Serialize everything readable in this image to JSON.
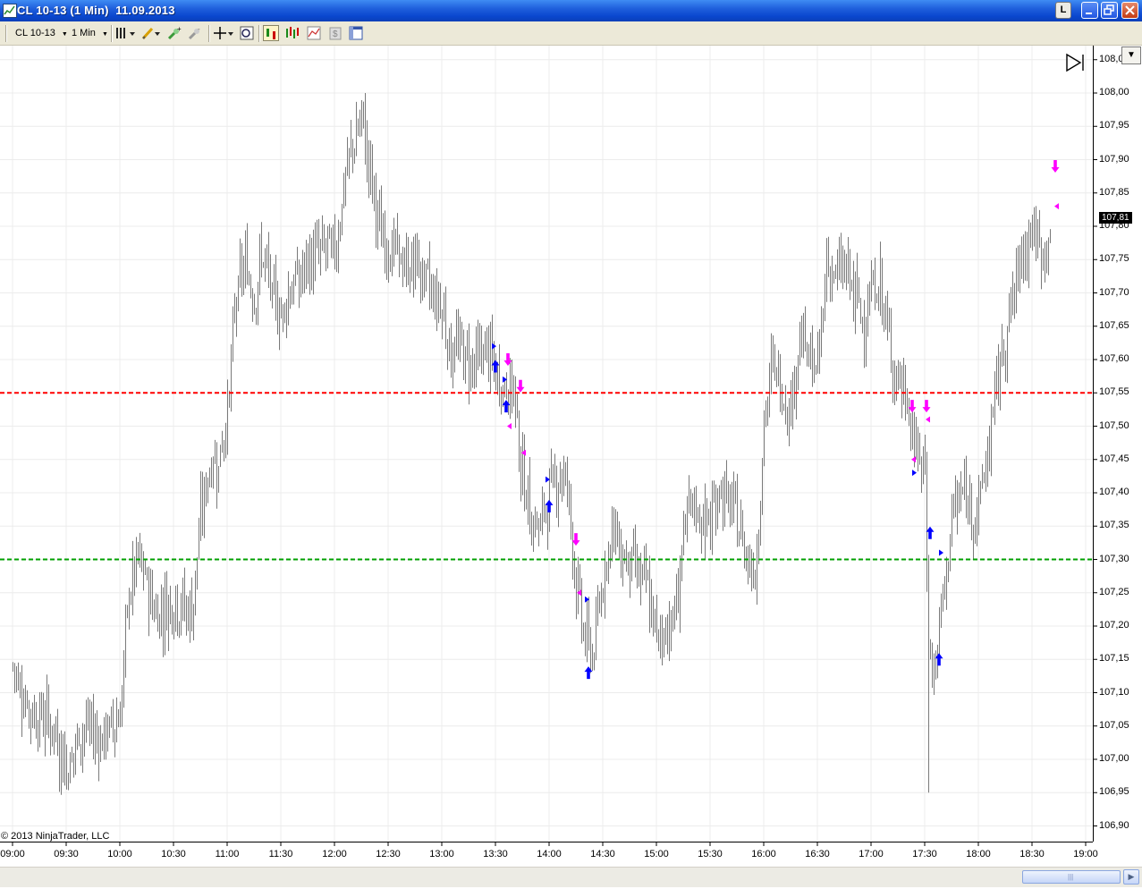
{
  "window": {
    "title": "CL 10-13 (1 Min)  11.09.2013",
    "buttons": {
      "link": "L",
      "minimize": "_",
      "maximize": "□",
      "close": "✕"
    }
  },
  "toolbar": {
    "instrument": "CL 10-13",
    "interval": "1 Min",
    "icons": [
      "bars-style-icon",
      "draw-pencil-icon",
      "zoom-in-icon",
      "zoom-out-icon",
      "crosshair-icon",
      "data-box-icon",
      "strategies-icon",
      "indicators-icon",
      "chart-properties-icon",
      "stock-icon",
      "panel-icon"
    ]
  },
  "colors": {
    "bars": "#7a7a7a",
    "resistance": "#ff0000",
    "support": "#00a000",
    "buy": "#0000ff",
    "sell": "#ff00ff",
    "grid": "#ececec"
  },
  "chart_data": {
    "type": "bar",
    "instrument": "CL 10-13",
    "interval": "1 Min",
    "date": "11.09.2013",
    "x_ticks": [
      "09:00",
      "09:30",
      "10:00",
      "10:30",
      "11:00",
      "11:30",
      "12:00",
      "12:30",
      "13:00",
      "13:30",
      "14:00",
      "14:30",
      "15:00",
      "15:30",
      "16:00",
      "16:30",
      "17:00",
      "17:30",
      "18:00",
      "18:30",
      "19:00"
    ],
    "y_ticks": [
      "108,05",
      "108,00",
      "107,95",
      "107,90",
      "107,85",
      "107,80",
      "107,75",
      "107,70",
      "107,65",
      "107,60",
      "107,55",
      "107,50",
      "107,45",
      "107,40",
      "107,35",
      "107,30",
      "107,25",
      "107,20",
      "107,15",
      "107,10",
      "107,05",
      "107,00",
      "106,95",
      "106,90"
    ],
    "ylim": [
      106.87,
      108.07
    ],
    "last_price": "107,81",
    "horizontal_lines": [
      {
        "name": "resistance",
        "value": 107.55,
        "color": "#ff0000",
        "style": "dashed"
      },
      {
        "name": "support",
        "value": 107.3,
        "color": "#00a000",
        "style": "dashed"
      }
    ],
    "anchors": [
      [
        "09:00",
        107.14
      ],
      [
        "09:10",
        107.07
      ],
      [
        "09:20",
        107.06
      ],
      [
        "09:30",
        106.99
      ],
      [
        "09:40",
        107.05
      ],
      [
        "09:50",
        107.03
      ],
      [
        "10:00",
        107.07
      ],
      [
        "10:05",
        107.25
      ],
      [
        "10:10",
        107.3
      ],
      [
        "10:20",
        107.22
      ],
      [
        "10:30",
        107.24
      ],
      [
        "10:40",
        107.22
      ],
      [
        "10:45",
        107.36
      ],
      [
        "10:50",
        107.44
      ],
      [
        "10:55",
        107.45
      ],
      [
        "11:00",
        107.52
      ],
      [
        "11:05",
        107.7
      ],
      [
        "11:10",
        107.74
      ],
      [
        "11:15",
        107.7
      ],
      [
        "11:20",
        107.76
      ],
      [
        "11:25",
        107.69
      ],
      [
        "11:30",
        107.67
      ],
      [
        "11:35",
        107.71
      ],
      [
        "11:40",
        107.72
      ],
      [
        "11:45",
        107.74
      ],
      [
        "11:50",
        107.76
      ],
      [
        "11:55",
        107.77
      ],
      [
        "12:00",
        107.76
      ],
      [
        "12:05",
        107.86
      ],
      [
        "12:10",
        107.92
      ],
      [
        "12:15",
        107.96
      ],
      [
        "12:20",
        107.88
      ],
      [
        "12:25",
        107.79
      ],
      [
        "12:30",
        107.77
      ],
      [
        "12:35",
        107.76
      ],
      [
        "12:40",
        107.73
      ],
      [
        "12:45",
        107.75
      ],
      [
        "12:50",
        107.72
      ],
      [
        "12:55",
        107.7
      ],
      [
        "13:00",
        107.68
      ],
      [
        "13:05",
        107.61
      ],
      [
        "13:10",
        107.62
      ],
      [
        "13:15",
        107.6
      ],
      [
        "13:20",
        107.6
      ],
      [
        "13:25",
        107.62
      ],
      [
        "13:30",
        107.57
      ],
      [
        "13:35",
        107.56
      ],
      [
        "13:40",
        107.56
      ],
      [
        "13:45",
        107.42
      ],
      [
        "13:50",
        107.36
      ],
      [
        "13:55",
        107.35
      ],
      [
        "14:00",
        107.4
      ],
      [
        "14:05",
        107.43
      ],
      [
        "14:10",
        107.42
      ],
      [
        "14:15",
        107.26
      ],
      [
        "14:20",
        107.18
      ],
      [
        "14:25",
        107.16
      ],
      [
        "14:30",
        107.28
      ],
      [
        "14:35",
        107.35
      ],
      [
        "14:40",
        107.31
      ],
      [
        "14:45",
        107.3
      ],
      [
        "14:50",
        107.28
      ],
      [
        "14:55",
        107.25
      ],
      [
        "15:00",
        107.18
      ],
      [
        "15:05",
        107.2
      ],
      [
        "15:10",
        107.21
      ],
      [
        "15:15",
        107.34
      ],
      [
        "15:20",
        107.38
      ],
      [
        "15:25",
        107.36
      ],
      [
        "15:30",
        107.35
      ],
      [
        "15:35",
        107.41
      ],
      [
        "15:40",
        107.38
      ],
      [
        "15:45",
        107.36
      ],
      [
        "15:50",
        107.31
      ],
      [
        "15:55",
        107.28
      ],
      [
        "16:00",
        107.5
      ],
      [
        "16:05",
        107.6
      ],
      [
        "16:10",
        107.55
      ],
      [
        "16:15",
        107.53
      ],
      [
        "16:20",
        107.64
      ],
      [
        "16:25",
        107.6
      ],
      [
        "16:30",
        107.58
      ],
      [
        "16:35",
        107.75
      ],
      [
        "16:40",
        107.72
      ],
      [
        "16:45",
        107.74
      ],
      [
        "16:50",
        107.7
      ],
      [
        "16:55",
        107.66
      ],
      [
        "17:00",
        107.7
      ],
      [
        "17:05",
        107.71
      ],
      [
        "17:10",
        107.62
      ],
      [
        "17:15",
        107.57
      ],
      [
        "17:20",
        107.53
      ],
      [
        "17:25",
        107.46
      ],
      [
        "17:30",
        107.43
      ],
      [
        "17:32",
        107.18
      ],
      [
        "17:35",
        107.12
      ],
      [
        "17:40",
        107.24
      ],
      [
        "17:45",
        107.36
      ],
      [
        "17:50",
        107.4
      ],
      [
        "17:55",
        107.38
      ],
      [
        "18:00",
        107.38
      ],
      [
        "18:05",
        107.46
      ],
      [
        "18:10",
        107.56
      ],
      [
        "18:15",
        107.64
      ],
      [
        "18:20",
        107.7
      ],
      [
        "18:25",
        107.77
      ],
      [
        "18:30",
        107.8
      ],
      [
        "18:35",
        107.75
      ],
      [
        "18:40",
        107.79
      ]
    ],
    "session_low": {
      "time": "17:32",
      "price": 106.95
    },
    "session_high": {
      "time": "12:17",
      "price": 108.0
    },
    "signals": [
      {
        "type": "buy-arrow",
        "time": "13:30",
        "price": 107.59
      },
      {
        "type": "buy-arrow",
        "time": "13:36",
        "price": 107.53
      },
      {
        "type": "buy-arrow",
        "time": "14:00",
        "price": 107.38
      },
      {
        "type": "buy-arrow",
        "time": "14:22",
        "price": 107.13
      },
      {
        "type": "buy-arrow",
        "time": "17:33",
        "price": 107.34
      },
      {
        "type": "buy-arrow",
        "time": "17:38",
        "price": 107.15
      },
      {
        "type": "sell-arrow",
        "time": "13:37",
        "price": 107.6
      },
      {
        "type": "sell-arrow",
        "time": "13:44",
        "price": 107.56
      },
      {
        "type": "sell-arrow",
        "time": "14:15",
        "price": 107.33
      },
      {
        "type": "sell-arrow",
        "time": "17:23",
        "price": 107.53
      },
      {
        "type": "sell-arrow",
        "time": "17:31",
        "price": 107.53
      },
      {
        "type": "sell-arrow",
        "time": "18:43",
        "price": 107.89
      },
      {
        "type": "buy-triangle",
        "time": "13:29",
        "price": 107.62
      },
      {
        "type": "buy-triangle",
        "time": "13:35",
        "price": 107.57
      },
      {
        "type": "buy-triangle",
        "time": "13:59",
        "price": 107.42
      },
      {
        "type": "buy-triangle",
        "time": "14:21",
        "price": 107.24
      },
      {
        "type": "buy-triangle",
        "time": "17:24",
        "price": 107.43
      },
      {
        "type": "buy-triangle",
        "time": "17:39",
        "price": 107.31
      },
      {
        "type": "sell-triangle",
        "time": "13:38",
        "price": 107.5
      },
      {
        "type": "sell-triangle",
        "time": "13:46",
        "price": 107.46
      },
      {
        "type": "sell-triangle",
        "time": "14:17",
        "price": 107.25
      },
      {
        "type": "sell-triangle",
        "time": "17:24",
        "price": 107.45
      },
      {
        "type": "sell-triangle",
        "time": "17:32",
        "price": 107.51
      },
      {
        "type": "sell-triangle",
        "time": "18:44",
        "price": 107.83
      }
    ]
  },
  "footer": {
    "copyright": "© 2013 NinjaTrader, LLC"
  }
}
